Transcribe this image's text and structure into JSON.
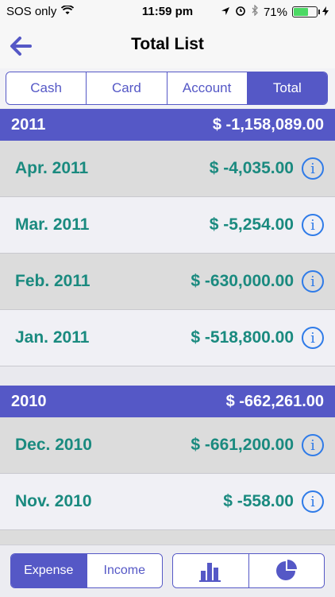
{
  "status": {
    "carrier": "SOS only",
    "time": "11:59 pm",
    "battery": "71%",
    "battery_level": 0.71
  },
  "nav": {
    "title": "Total List"
  },
  "tabs": [
    {
      "label": "Cash"
    },
    {
      "label": "Card"
    },
    {
      "label": "Account"
    },
    {
      "label": "Total",
      "active": true
    }
  ],
  "groups": [
    {
      "year": "2011",
      "total": "$ -1,158,089.00",
      "rows": [
        {
          "label": "Apr. 2011",
          "amount": "$ -4,035.00"
        },
        {
          "label": "Mar. 2011",
          "amount": "$ -5,254.00"
        },
        {
          "label": "Feb. 2011",
          "amount": "$ -630,000.00"
        },
        {
          "label": "Jan. 2011",
          "amount": "$ -518,800.00"
        }
      ]
    },
    {
      "year": "2010",
      "total": "$ -662,261.00",
      "rows": [
        {
          "label": "Dec. 2010",
          "amount": "$ -661,200.00"
        },
        {
          "label": "Nov. 2010",
          "amount": "$ -558.00"
        }
      ]
    }
  ],
  "bottom": {
    "expense": "Expense",
    "income": "Income",
    "icons": [
      "bar-chart-icon",
      "pie-chart-icon"
    ]
  },
  "colors": {
    "accent": "#5558c6",
    "amount": "#1a8a7f",
    "info": "#2f7be8"
  }
}
